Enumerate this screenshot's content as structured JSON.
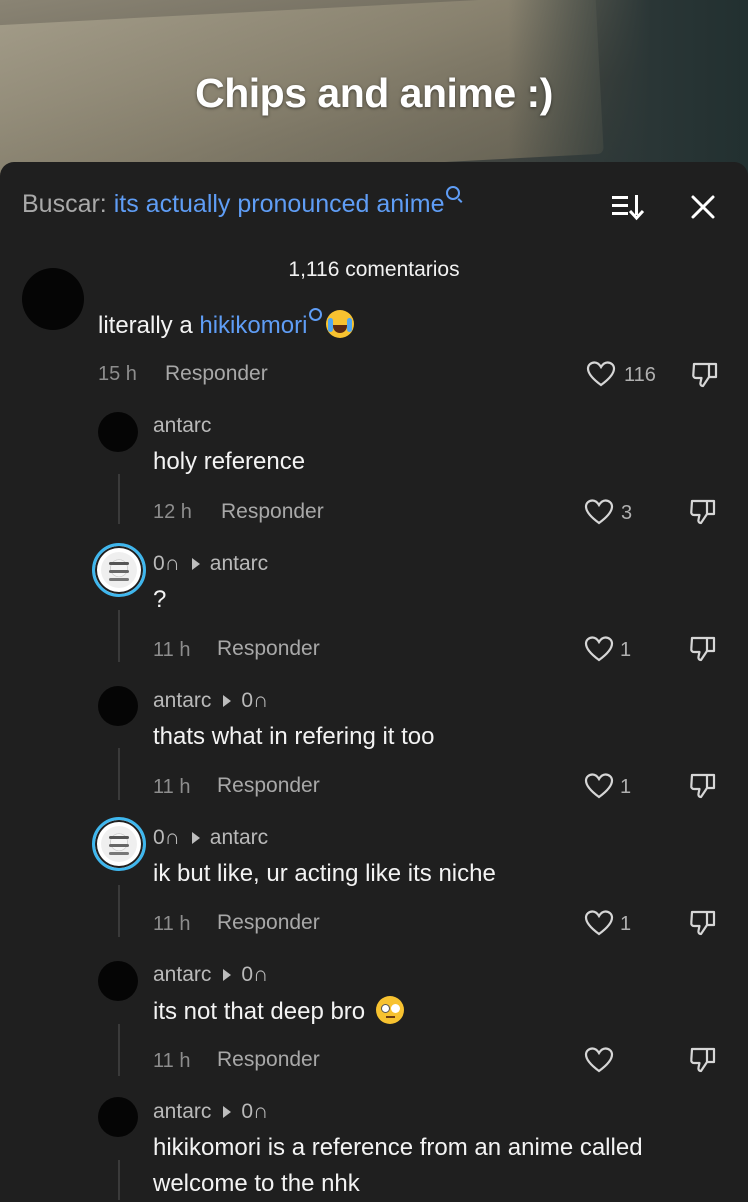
{
  "video": {
    "caption": "Chips and anime :)"
  },
  "search": {
    "label": "Buscar:",
    "query": "its actually pronounced anime"
  },
  "comments_count": "1,116 comentarios",
  "reply_label": "Responder",
  "comments": [
    {
      "text_prefix": "literally a ",
      "link": "hikikomori",
      "time": "15 h",
      "likes": "116"
    },
    {
      "user": "antarc",
      "text": "holy reference",
      "time": "12 h",
      "likes": "3"
    },
    {
      "user": "0∩",
      "reply_to": "antarc",
      "text": "?",
      "time": "11 h",
      "likes": "1"
    },
    {
      "user": "antarc",
      "reply_to": "0∩",
      "text": "thats what in refering it too",
      "time": "11 h",
      "likes": "1"
    },
    {
      "user": "0∩",
      "reply_to": "antarc",
      "text": "ik but like, ur acting like its niche",
      "time": "11 h",
      "likes": "1"
    },
    {
      "user": "antarc",
      "reply_to": "0∩",
      "text": "its not that deep bro",
      "time": "11 h",
      "likes": ""
    },
    {
      "user": "antarc",
      "reply_to": "0∩",
      "text_line1": "hikikomori is a reference from an anime called",
      "text_line2": "welcome to the nhk"
    }
  ]
}
